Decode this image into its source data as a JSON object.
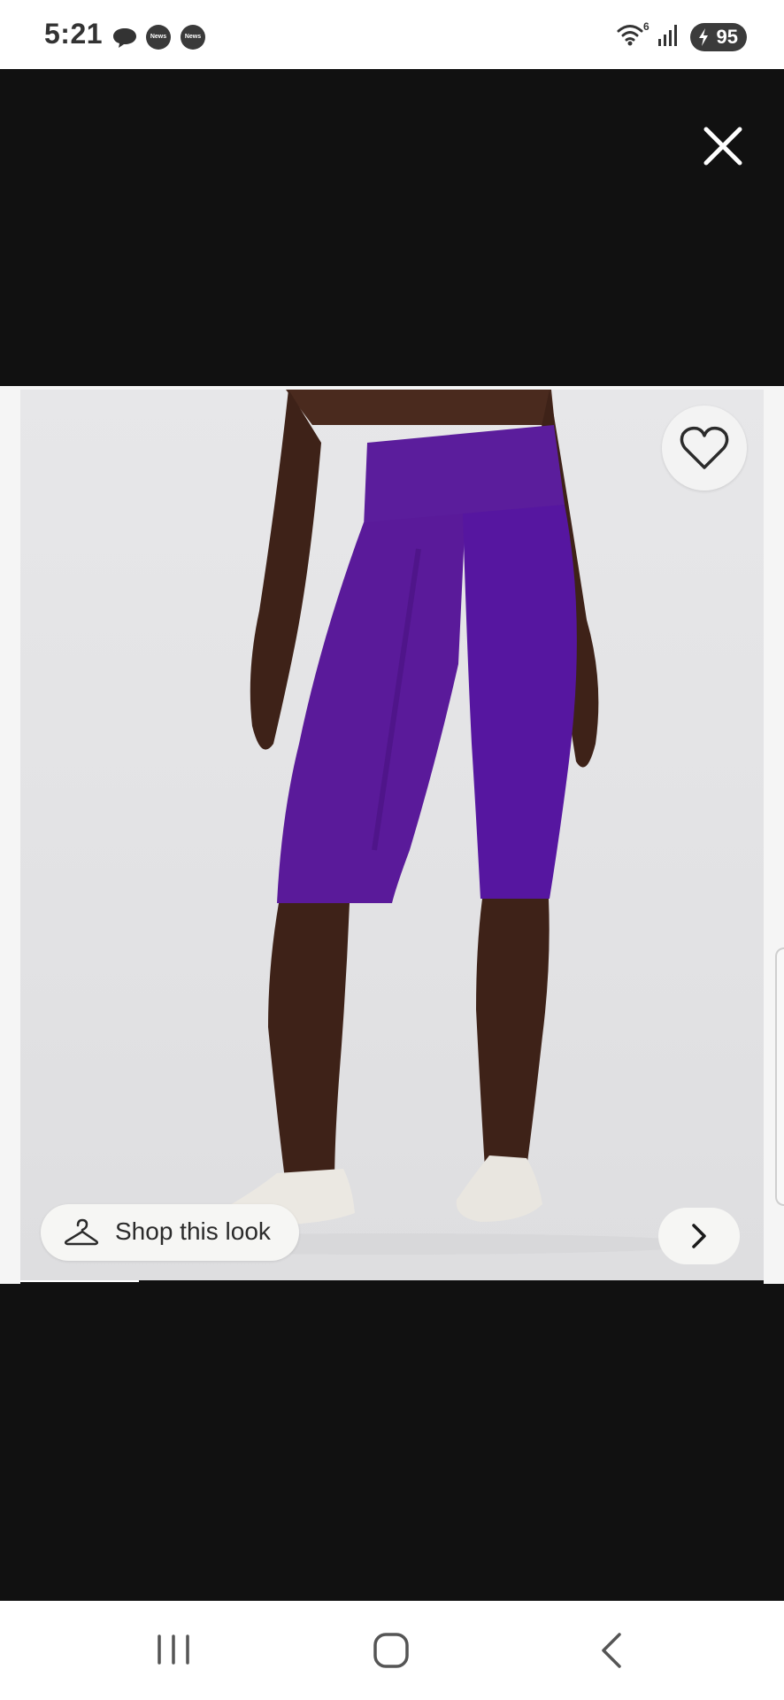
{
  "status_bar": {
    "time": "5:21",
    "notifications": [
      {
        "icon": "chat-bubble-icon"
      },
      {
        "label": "News",
        "icon": "news-icon"
      },
      {
        "label": "News",
        "icon": "news-icon"
      }
    ],
    "wifi_badge": "6",
    "battery": "95"
  },
  "viewer": {
    "close_icon": "close-icon",
    "favorite_icon": "heart-icon",
    "product_image": {
      "subject": "purple high-rise knee-length leggings",
      "colors": {
        "garment": "#5a1a9a",
        "background": "#e4e4e6"
      }
    },
    "shop_look_label": "Shop this look",
    "next_icon": "chevron-right-icon",
    "progress": 0.16
  },
  "nav_bar": {
    "recents_icon": "recents-icon",
    "home_icon": "home-icon",
    "back_icon": "back-icon"
  }
}
